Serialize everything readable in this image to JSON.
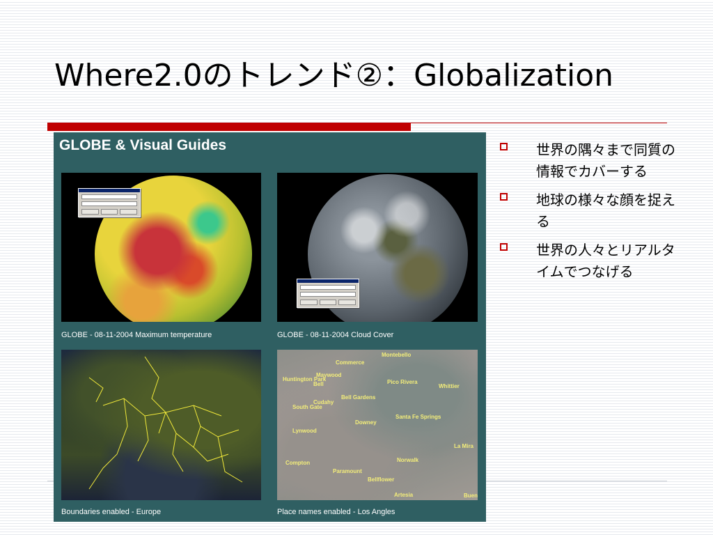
{
  "slide": {
    "title": "Where2.0のトレンド②：Globalization"
  },
  "panel": {
    "title": "GLOBE & Visual Guides",
    "captions": [
      "GLOBE - 08-11-2004 Maximum temperature",
      "GLOBE - 08-11-2004 Cloud Cover",
      "Boundaries enabled - Europe",
      "Place names enabled - Los Angles"
    ],
    "place_names": [
      "Montebello",
      "Commerce",
      "Maywood",
      "Huntington Park",
      "Bell",
      "Pico Rivera",
      "Whittier",
      "Bell Gardens",
      "Cudahy",
      "South Gate",
      "Downey",
      "Santa Fe Springs",
      "Lynwood",
      "La Mira",
      "Norwalk",
      "Compton",
      "Paramount",
      "Bellflower",
      "Artesia",
      "Buen"
    ]
  },
  "bullets": [
    "世界の隅々まで同質の情報でカバーする",
    "地球の様々な顔を捉える",
    "世界の人々とリアルタイムでつなげる"
  ],
  "colors": {
    "accent_red": "#c00000",
    "panel_bg": "#2f5f62"
  }
}
